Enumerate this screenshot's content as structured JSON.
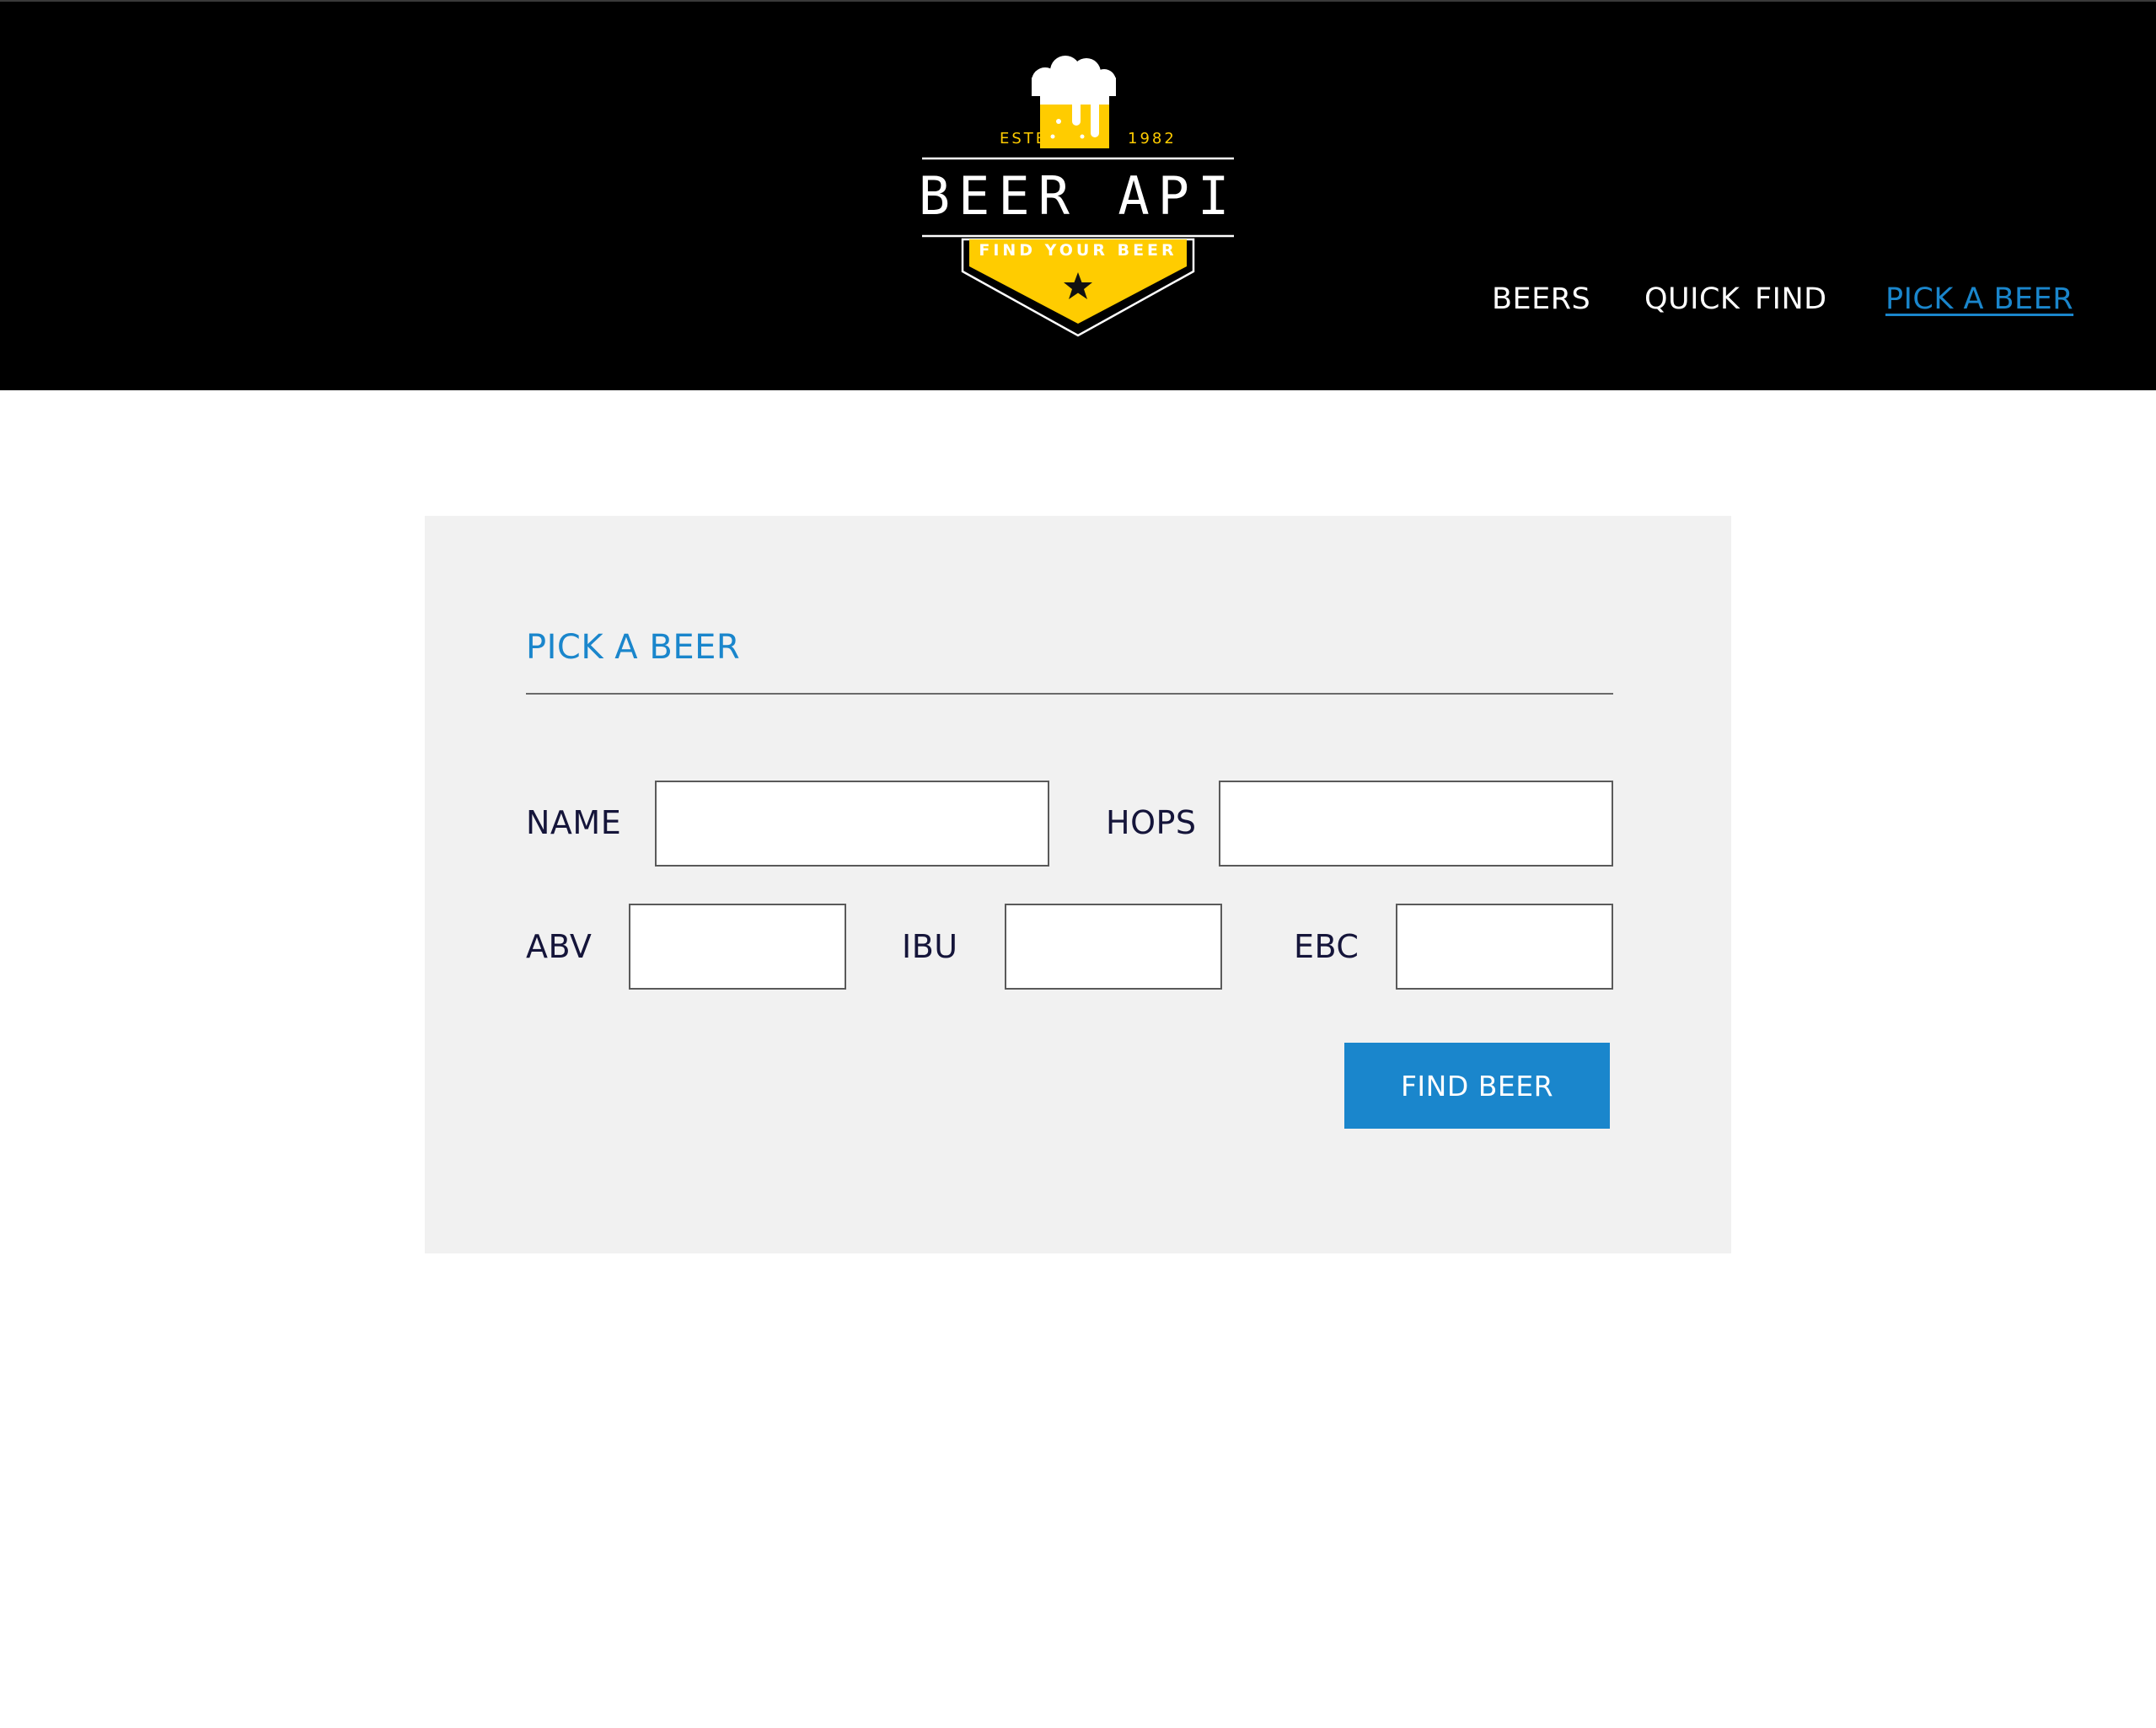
{
  "header": {
    "logo": {
      "estb": "ESTB",
      "year": "1982",
      "name": "BEER API",
      "tagline": "FIND YOUR BEER",
      "brand_yellow": "#ffcc00"
    },
    "nav": [
      {
        "label": "BEERS",
        "active": false
      },
      {
        "label": "QUICK FIND",
        "active": false
      },
      {
        "label": "PICK A BEER",
        "active": true
      }
    ]
  },
  "colors": {
    "header_bg": "#000000",
    "accent": "#1a86cc",
    "card_bg": "#f1f1f1",
    "label_text": "#15153a"
  },
  "form": {
    "title": "PICK A BEER",
    "fields": {
      "name": {
        "label": "NAME",
        "value": ""
      },
      "hops": {
        "label": "HOPS",
        "value": ""
      },
      "abv": {
        "label": "ABV",
        "value": ""
      },
      "ibu": {
        "label": "IBU",
        "value": ""
      },
      "ebc": {
        "label": "EBC",
        "value": ""
      }
    },
    "submit_label": "FIND BEER"
  }
}
